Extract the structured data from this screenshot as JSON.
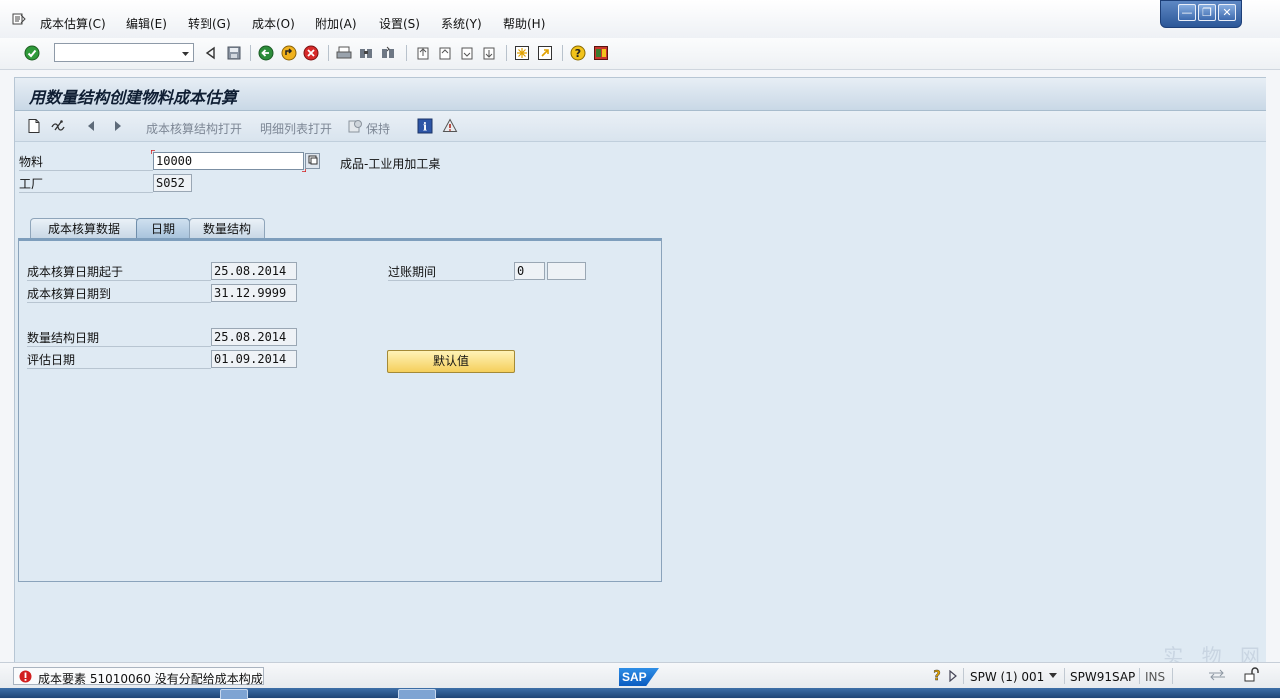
{
  "menu": {
    "items": [
      "成本估算(C)",
      "编辑(E)",
      "转到(G)",
      "成本(O)",
      "附加(A)",
      "设置(S)",
      "系统(Y)",
      "帮助(H)"
    ]
  },
  "window_controls": {
    "minimize": "—",
    "restore": "❐",
    "close": "✕"
  },
  "toolbar": {
    "command_value": ""
  },
  "screen": {
    "title": "用数量结构创建物料成本估算"
  },
  "app_toolbar": {
    "open_costing_structure": "成本核算结构打开",
    "open_itemization": "明细列表打开",
    "keep": "保持"
  },
  "header_fields": {
    "material_label": "物料",
    "material_value": "10000",
    "material_desc": "成品-工业用加工桌",
    "plant_label": "工厂",
    "plant_value": "S052"
  },
  "tabs": [
    "成本核算数据",
    "日期",
    "数量结构"
  ],
  "active_tab": "日期",
  "dates": {
    "costing_date_from_label": "成本核算日期起于",
    "costing_date_from": "25.08.2014",
    "costing_date_to_label": "成本核算日期到",
    "costing_date_to": "31.12.9999",
    "qty_struct_date_label": "数量结构日期",
    "qty_struct_date": "25.08.2014",
    "valuation_date_label": "评估日期",
    "valuation_date": "01.09.2014",
    "posting_period_label": "过账期间",
    "posting_period": "0",
    "posting_year": "",
    "default_button": "默认值"
  },
  "status": {
    "message": "成本要素 51010060 没有分配给成本构成",
    "sap_logo": "SAP",
    "system": "SPW (1) 001",
    "server": "SPW91SAP",
    "mode": "INS"
  },
  "colors": {
    "accent": "#0b5cc0",
    "error": "#d21f1f",
    "button": "#f5cf5c"
  },
  "watermark": "实 物 网"
}
